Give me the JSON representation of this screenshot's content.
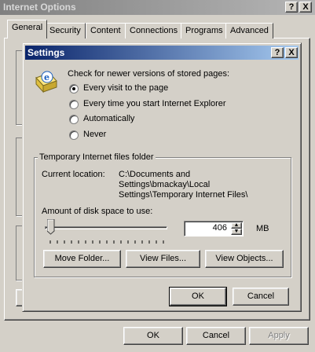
{
  "outer": {
    "title": "Internet Options",
    "help_label": "?",
    "close_label": "X",
    "tabs": [
      "General",
      "Security",
      "Content",
      "Connections",
      "Programs",
      "Advanced"
    ],
    "active_tab": "General",
    "ok_label": "OK",
    "cancel_label": "Cancel",
    "apply_label": "Apply"
  },
  "settings": {
    "title": "Settings",
    "help_label": "?",
    "close_label": "X",
    "check_prompt": "Check for newer versions of stored pages:",
    "options": [
      {
        "label": "Every visit to the page",
        "checked": true
      },
      {
        "label": "Every time you start Internet Explorer",
        "checked": false
      },
      {
        "label": "Automatically",
        "checked": false
      },
      {
        "label": "Never",
        "checked": false
      }
    ],
    "temp_group_label": "Temporary Internet files folder",
    "current_location_label": "Current location:",
    "current_location_lines": [
      "C:\\Documents and",
      "Settings\\bmackay\\Local",
      "Settings\\Temporary Internet Files\\"
    ],
    "disk_space_label": "Amount of disk space to use:",
    "disk_space_value": "406",
    "disk_space_unit": "MB",
    "move_folder_label": "Move Folder...",
    "view_files_label": "View Files...",
    "view_objects_label": "View Objects...",
    "ok_label": "OK",
    "cancel_label": "Cancel"
  }
}
